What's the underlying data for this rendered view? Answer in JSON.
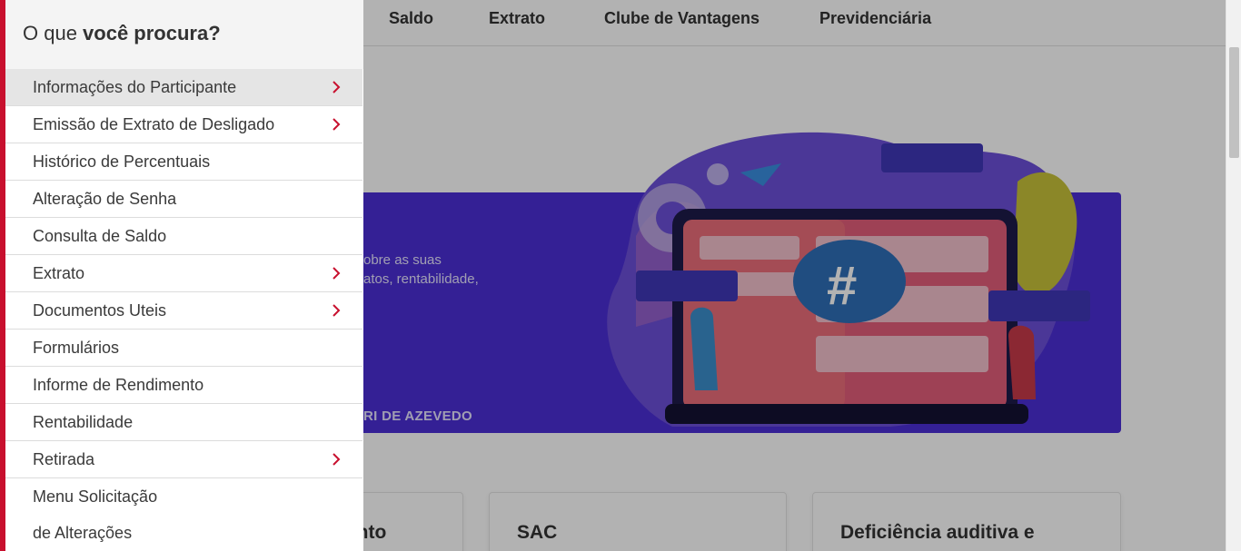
{
  "topnav": {
    "items": [
      "Saldo",
      "Extrato",
      "Clube de Vantagens",
      "Previdenciária"
    ]
  },
  "banner": {
    "text_line1": "obre as suas",
    "text_line2": "atos, rentabilidade,",
    "author": "RI DE AZEVEDO"
  },
  "cards": [
    "ento",
    "SAC",
    "Deficiência auditiva e"
  ],
  "drawer": {
    "title_prefix": "O que ",
    "title_bold": "você procura?",
    "items": [
      {
        "label": "Informações do Participante",
        "has_submenu": true
      },
      {
        "label": "Emissão de Extrato de Desligado",
        "has_submenu": true
      },
      {
        "label": "Histórico de Percentuais",
        "has_submenu": false
      },
      {
        "label": "Alteração de Senha",
        "has_submenu": false
      },
      {
        "label": "Consulta de Saldo",
        "has_submenu": false
      },
      {
        "label": "Extrato",
        "has_submenu": true
      },
      {
        "label": "Documentos Uteis",
        "has_submenu": true
      },
      {
        "label": "Formulários",
        "has_submenu": false
      },
      {
        "label": "Informe de Rendimento",
        "has_submenu": false
      },
      {
        "label": "Rentabilidade",
        "has_submenu": false
      },
      {
        "label": "Retirada",
        "has_submenu": true
      },
      {
        "label": "Menu Solicitação",
        "has_submenu": false
      },
      {
        "label": "de Alterações",
        "has_submenu": false
      }
    ]
  },
  "colors": {
    "accent": "#c8102e",
    "banner": "#4b2fd6"
  },
  "icons": {
    "submenu": "chevron-right-icon"
  }
}
